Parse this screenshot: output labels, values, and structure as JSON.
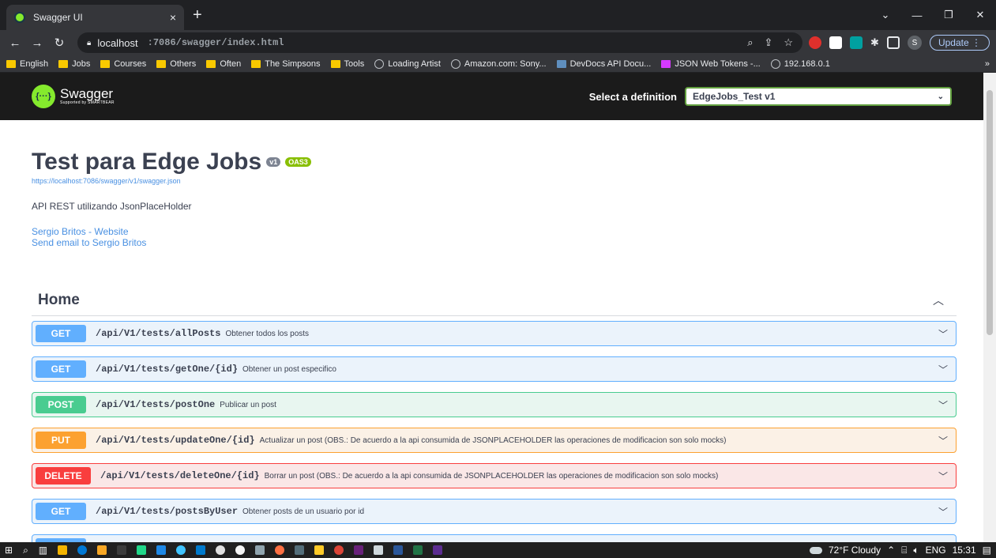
{
  "browser": {
    "tab_title": "Swagger UI",
    "tab_close": "×",
    "new_tab": "+",
    "url_host": "localhost",
    "url_path": ":7086/swagger/index.html",
    "update_label": "Update",
    "profile_initial": "S",
    "bookmarks": [
      {
        "label": "English",
        "icon": "folder"
      },
      {
        "label": "Jobs",
        "icon": "folder"
      },
      {
        "label": "Courses",
        "icon": "folder"
      },
      {
        "label": "Others",
        "icon": "folder"
      },
      {
        "label": "Often",
        "icon": "folder"
      },
      {
        "label": "The Simpsons",
        "icon": "folder"
      },
      {
        "label": "Tools",
        "icon": "folder"
      },
      {
        "label": "Loading Artist",
        "icon": "globe"
      },
      {
        "label": "Amazon.com: Sony...",
        "icon": "globe"
      },
      {
        "label": "DevDocs API Docu...",
        "icon": "devdocs"
      },
      {
        "label": "JSON Web Tokens -...",
        "icon": "jwt"
      },
      {
        "label": "192.168.0.1",
        "icon": "globe"
      }
    ],
    "more_bookmarks": "»"
  },
  "swagger": {
    "logo_text": "Swagger",
    "logo_sub": "Supported by SMARTBEAR",
    "select_label": "Select a definition",
    "selected_definition": "EdgeJobs_Test v1",
    "title": "Test para Edge Jobs",
    "version_badge": "v1",
    "oas_badge": "OAS3",
    "spec_url": "https://localhost:7086/swagger/v1/swagger.json",
    "description": "API REST utilizando JsonPlaceHolder",
    "contact_website": "Sergio Britos - Website",
    "contact_email": "Send email to Sergio Britos",
    "tag_name": "Home",
    "operations": [
      {
        "method": "GET",
        "path": "/api/V1/tests/allPosts",
        "summary": "Obtener todos los posts"
      },
      {
        "method": "GET",
        "path": "/api/V1/tests/getOne/{id}",
        "summary": "Obtener un post especifico"
      },
      {
        "method": "POST",
        "path": "/api/V1/tests/postOne",
        "summary": "Publicar un post"
      },
      {
        "method": "PUT",
        "path": "/api/V1/tests/updateOne/{id}",
        "summary": "Actualizar un post (OBS.: De acuerdo a la api consumida de JSONPLACEHOLDER las operaciones de modificacion son solo mocks)"
      },
      {
        "method": "DELETE",
        "path": "/api/V1/tests/deleteOne/{id}",
        "summary": "Borrar un post (OBS.: De acuerdo a la api consumida de JSONPLACEHOLDER las operaciones de modificacion son solo mocks)"
      },
      {
        "method": "GET",
        "path": "/api/V1/tests/postsByUser",
        "summary": "Obtener posts de un usuario por id"
      },
      {
        "method": "GET",
        "path": "",
        "summary": ""
      }
    ]
  },
  "taskbar": {
    "weather": "72°F Cloudy",
    "language": "ENG",
    "time": "15:31"
  },
  "colors": {
    "get": "#61affe",
    "post": "#49cc90",
    "put": "#fca130",
    "delete": "#f93e3e",
    "swagger_green": "#85ea2d",
    "topbar": "#1b1b1b"
  }
}
